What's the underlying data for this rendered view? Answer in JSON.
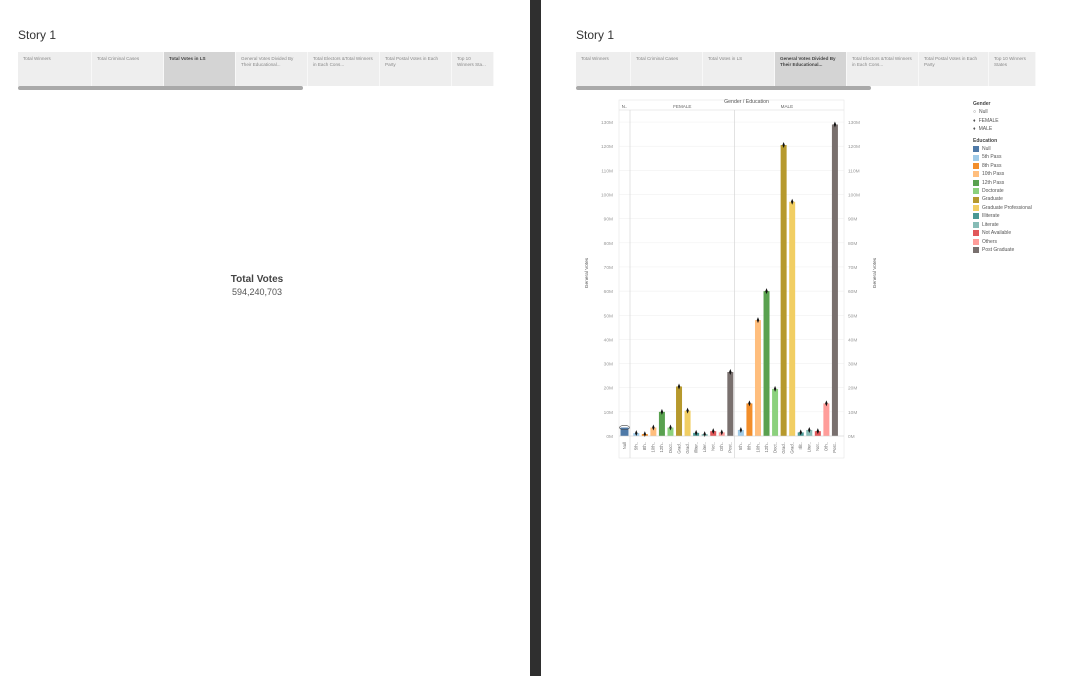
{
  "story_title": "Story 1",
  "tabs": [
    {
      "label": "Total Winners"
    },
    {
      "label": "Total Criminal Cases"
    },
    {
      "label": "Total Votes in LS"
    },
    {
      "label": "General Votes Divided By Their Educational..."
    },
    {
      "label": "Total Electors &Total Winners in Each Cons..."
    },
    {
      "label": "Total Postal Votes in Each Party"
    },
    {
      "label": "Top 10 Winners Sta..."
    }
  ],
  "left": {
    "active_tab": 2,
    "kpi_label": "Total Votes",
    "kpi_value": "594,240,703"
  },
  "right": {
    "active_tab": 3,
    "last_tab_label": "Top 10 Winners States"
  },
  "chart_data": {
    "type": "bar",
    "title": "Gender / Education",
    "panels": [
      "N..",
      "FEMALE",
      "MALE"
    ],
    "ylabel": "General Votes",
    "y_ticks": [
      "0M",
      "10M",
      "20M",
      "30M",
      "40M",
      "50M",
      "60M",
      "70M",
      "80M",
      "90M",
      "100M",
      "110M",
      "120M",
      "130M"
    ],
    "ylim": [
      0,
      135
    ],
    "grid": true,
    "legend_placement": "right",
    "gender_legend": {
      "title": "Gender",
      "items": [
        "Null",
        "FEMALE",
        "MALE"
      ]
    },
    "education_legend": {
      "title": "Education",
      "items": [
        {
          "name": "Null",
          "color": "#4e79a7"
        },
        {
          "name": "5th Pass",
          "color": "#a0cbe8"
        },
        {
          "name": "8th Pass",
          "color": "#f28e2b"
        },
        {
          "name": "10th Pass",
          "color": "#ffbe7d"
        },
        {
          "name": "12th Pass",
          "color": "#59a14f"
        },
        {
          "name": "Doctorate",
          "color": "#8cd17d"
        },
        {
          "name": "Graduate",
          "color": "#b6992d"
        },
        {
          "name": "Graduate Professional",
          "color": "#f1ce63"
        },
        {
          "name": "Illiterate",
          "color": "#499894"
        },
        {
          "name": "Literate",
          "color": "#86bcb6"
        },
        {
          "name": "Not Available",
          "color": "#e15759"
        },
        {
          "name": "Others",
          "color": "#ff9d9a"
        },
        {
          "name": "Post Graduate",
          "color": "#79706e"
        }
      ]
    },
    "series": [
      {
        "gender": "Null",
        "categories": [
          "Null"
        ],
        "labels": [
          "Null"
        ],
        "values": [
          3.5
        ]
      },
      {
        "gender": "FEMALE",
        "categories": [
          "5th Pass",
          "8th Pass",
          "10th Pass",
          "12th Pass",
          "Doctorate",
          "Graduate",
          "Graduate Professional",
          "Illiterate",
          "Literate",
          "Not Available",
          "Others",
          "Post Graduate"
        ],
        "labels": [
          "5th..",
          "8th..",
          "10th..",
          "12th..",
          "Doct..",
          "Grad..",
          "Grad..",
          "Illiter..",
          "Liter..",
          "Not..",
          "Oth..",
          "Post.."
        ],
        "values": [
          1.2,
          0.8,
          3.5,
          10,
          3.5,
          20.5,
          10.5,
          1.3,
          0.8,
          2,
          1.5,
          26.5
        ]
      },
      {
        "gender": "MALE",
        "categories": [
          "5th Pass",
          "8th Pass",
          "10th Pass",
          "12th Pass",
          "Doctorate",
          "Graduate",
          "Graduate Professional",
          "Illiterate",
          "Literate",
          "Not Available",
          "Others",
          "Post Graduate"
        ],
        "labels": [
          "5th..",
          "8th..",
          "10th..",
          "12th..",
          "Doct..",
          "Grad..",
          "Grad..",
          "Illit..",
          "Liter..",
          "Not..",
          "Oth..",
          "Post.."
        ],
        "values": [
          2.5,
          13.5,
          48,
          60,
          19.5,
          120.5,
          97,
          1.5,
          2.5,
          2,
          13.5,
          129
        ]
      }
    ]
  }
}
